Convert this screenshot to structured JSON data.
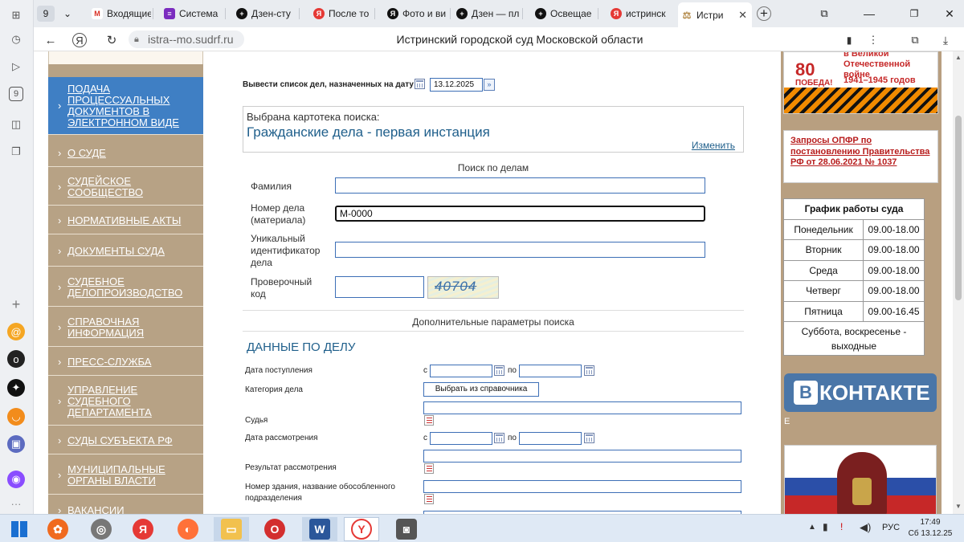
{
  "browser": {
    "tab_count_badge": "9",
    "tabs": [
      {
        "label": "Входящие",
        "color": "#d93025",
        "glyph": "M"
      },
      {
        "label": "Система ",
        "color": "#7b2cbf",
        "glyph": "≡"
      },
      {
        "label": "Дзен-сту",
        "color": "#111111",
        "glyph": "+"
      },
      {
        "label": "После то",
        "color": "#e53935",
        "glyph": "Я"
      },
      {
        "label": "Фото и ви",
        "color": "#111111",
        "glyph": "Я"
      },
      {
        "label": "Дзен — пл",
        "color": "#111111",
        "glyph": "+"
      },
      {
        "label": "Освещае",
        "color": "#111111",
        "glyph": "+"
      },
      {
        "label": "истринск",
        "color": "#e53935",
        "glyph": "Я"
      },
      {
        "label": "Истри",
        "color": "#b38a4a",
        "glyph": "⚖"
      }
    ],
    "url": "istra--mo.sudrf.ru",
    "page_title": "Истринский городской суд Московской области"
  },
  "left_nav": {
    "items": [
      {
        "label": "ПОДАЧА ПРОЦЕССУАЛЬНЫХ ДОКУМЕНТОВ В ЭЛЕКТРОННОМ ВИДЕ"
      },
      {
        "label": "О СУДЕ"
      },
      {
        "label": "СУДЕЙСКОЕ СООБЩЕСТВО"
      },
      {
        "label": "НОРМАТИВНЫЕ АКТЫ"
      },
      {
        "label": "ДОКУМЕНТЫ СУДА"
      },
      {
        "label": "СУДЕБНОЕ ДЕЛОПРОИЗВОДСТВО"
      },
      {
        "label": "СПРАВОЧНАЯ ИНФОРМАЦИЯ"
      },
      {
        "label": "ПРЕСС-СЛУЖБА"
      },
      {
        "label": "УПРАВЛЕНИЕ СУДЕБНОГО ДЕПАРТАМЕНТА"
      },
      {
        "label": "СУДЫ СУБЪЕКТА РФ"
      },
      {
        "label": "МУНИЦИПАЛЬНЫЕ ОРГАНЫ ВЛАСТИ"
      },
      {
        "label": "ВАКАНСИИ"
      }
    ]
  },
  "search": {
    "date_label": "Вывести список дел, назначенных на дату",
    "date_value": "13.12.2025",
    "catalog_label": "Выбрана картотека поиска:",
    "catalog_value": "Гражданские дела - первая инстанция",
    "change_link": "Изменить",
    "section_title": "Поиск по делам",
    "surname_label": "Фамилия",
    "surname_value": "",
    "case_number_label": "Номер дела (материала)",
    "case_number_value": "М-0000",
    "uid_label": "Уникальный идентификатор дела",
    "uid_value": "",
    "captcha_label": "Проверочный код",
    "captcha_value": "",
    "captcha_image_text": "40704",
    "extra_params": "Дополнительные параметры поиска"
  },
  "case_data": {
    "heading": "ДАННЫЕ ПО ДЕЛУ",
    "received_label": "Дата поступления",
    "from": "с",
    "to": "по",
    "category_label": "Категория дела",
    "category_button": "Выбрать из справочника",
    "judge_label": "Судья",
    "review_date_label": "Дата рассмотрения",
    "result_label": "Результат рассмотрения",
    "building_label": "Номер здания, название обособленного подразделения"
  },
  "right": {
    "banner_top": "в Великой Отечественной войне",
    "banner_years": "1941–1945 годов",
    "banner_80": "80",
    "banner_pobeda": "ПОБЕДА!",
    "pfr_link": "Запросы ОПФР по постановлению Правительства РФ от 28.06.2021 № 1037",
    "schedule_title": "График работы суда",
    "schedule": [
      {
        "day": "Понедельник",
        "hours": "09.00-18.00"
      },
      {
        "day": "Вторник",
        "hours": "09.00-18.00"
      },
      {
        "day": "Среда",
        "hours": "09.00-18.00"
      },
      {
        "day": "Четверг",
        "hours": "09.00-18.00"
      },
      {
        "day": "Пятница",
        "hours": "09.00-16.45"
      }
    ],
    "weekend": "Суббота, воскресенье - выходные",
    "vk_label": "ВКонтакте",
    "vk_small": "Е"
  },
  "taskbar": {
    "lang": "РУС",
    "time": "17:49",
    "date": "Сб 13.12.25"
  }
}
